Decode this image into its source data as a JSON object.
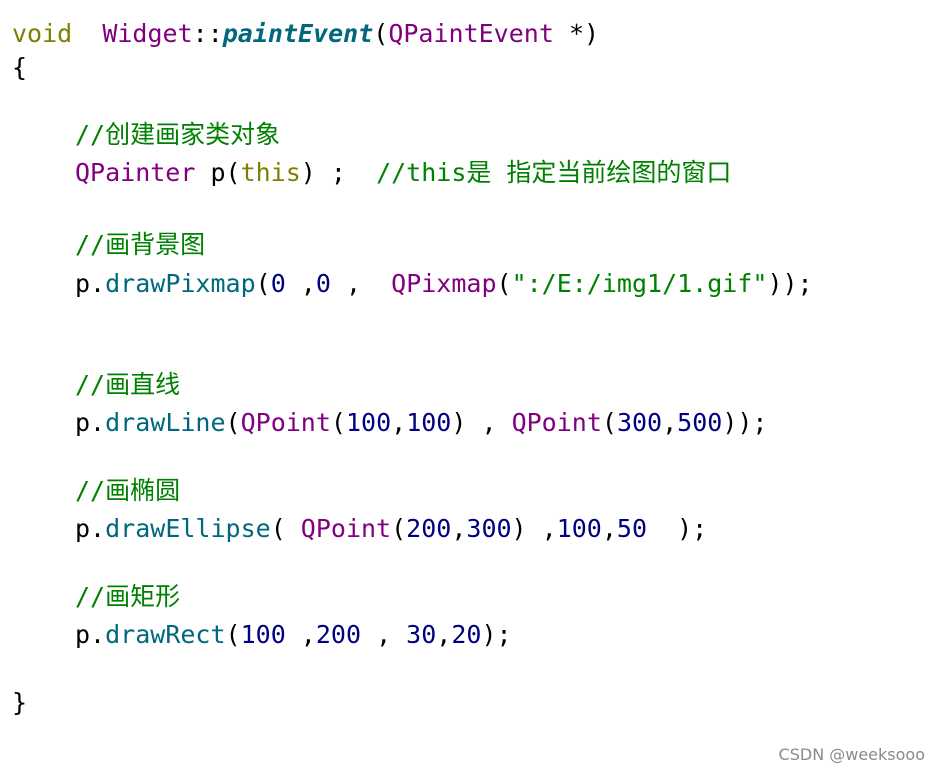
{
  "code": {
    "l1": {
      "kw": "void",
      "gap": "  ",
      "cls": "Widget",
      "scope": "::",
      "fn": "paintEvent",
      "open": "(",
      "arg": "QPaintEvent",
      "rest": " *)"
    },
    "l2": "{",
    "l3": "//创建画家类对象",
    "l4": {
      "cls": "QPainter",
      "var": " p(",
      "kw": "this",
      "mid": ") ;  ",
      "cmt": "//this是 指定当前绘图的窗口"
    },
    "l5": "//画背景图",
    "l6": {
      "obj": "p.",
      "mtd": "drawPixmap",
      "open": "(",
      "n1": "0",
      "sep1": " ,",
      "n2": "0",
      "sep2": " ,  ",
      "cls": "QPixmap",
      "open2": "(",
      "str": "\":/E:/img1/1.gif\"",
      "close": "));"
    },
    "l7": "//画直线",
    "l8": {
      "obj": "p.",
      "mtd": "drawLine",
      "open": "(",
      "cls1": "QPoint",
      "open2": "(",
      "n1": "100",
      "c1": ",",
      "n2": "100",
      "close1": ") , ",
      "cls2": "QPoint",
      "open3": "(",
      "n3": "300",
      "c2": ",",
      "n4": "500",
      "close2": "));"
    },
    "l9": "//画椭圆",
    "l10": {
      "obj": "p.",
      "mtd": "drawEllipse",
      "open": "( ",
      "cls": "QPoint",
      "open2": "(",
      "n1": "200",
      "c1": ",",
      "n2": "300",
      "close1": ") ,",
      "n3": "100",
      "c2": ",",
      "n4": "50",
      "close2": "  );"
    },
    "l11": "//画矩形",
    "l12": {
      "obj": "p.",
      "mtd": "drawRect",
      "open": "(",
      "n1": "100",
      "sep1": " ,",
      "n2": "200",
      "sep2": " , ",
      "n3": "30",
      "c1": ",",
      "n4": "20",
      "close": ");"
    },
    "l13": "}"
  },
  "watermark": "CSDN @weeksooo"
}
